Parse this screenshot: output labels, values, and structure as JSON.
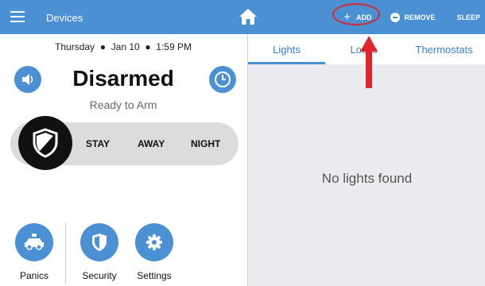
{
  "topbar": {
    "title": "Devices",
    "add_label": "ADD",
    "remove_label": "REMOVE",
    "sleep_label": "SLEEP"
  },
  "left": {
    "date_day": "Thursday",
    "date_date": "Jan 10",
    "date_time": "1:59 PM",
    "status": "Disarmed",
    "substatus": "Ready to Arm",
    "arm_options": [
      "STAY",
      "AWAY",
      "NIGHT"
    ],
    "bottom": {
      "panics": "Panics",
      "security": "Security",
      "settings": "Settings"
    }
  },
  "right": {
    "tabs": [
      "Lights",
      "Locks",
      "Thermostats"
    ],
    "active_tab": "Lights",
    "empty_message": "No lights found"
  },
  "colors": {
    "accent": "#4a90d2",
    "highlight": "#d8262b"
  }
}
